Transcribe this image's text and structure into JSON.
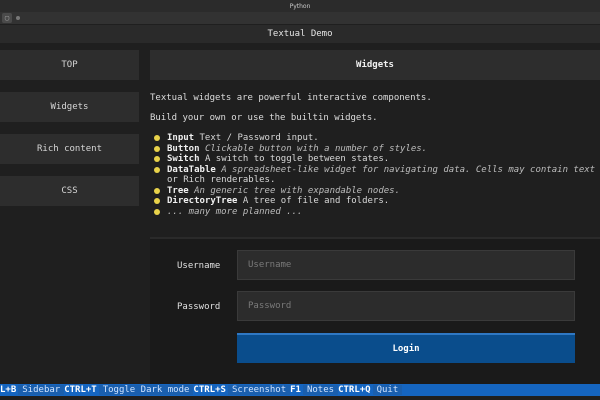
{
  "window": {
    "title": "Python"
  },
  "app": {
    "title": "Textual Demo"
  },
  "sidebar": {
    "items": [
      {
        "label": "TOP"
      },
      {
        "label": "Widgets"
      },
      {
        "label": "Rich content"
      },
      {
        "label": "CSS"
      }
    ]
  },
  "main": {
    "section_title": "Widgets",
    "intro": "Textual widgets are powerful interactive components.",
    "intro2": "Build your own or use the builtin widgets.",
    "list": [
      {
        "name": "Input",
        "desc": "Text / Password input."
      },
      {
        "name": "Button",
        "desc": "Clickable button with a number of styles."
      },
      {
        "name": "Switch",
        "desc": "A switch to toggle between states."
      },
      {
        "name": "DataTable",
        "desc": "A spreadsheet-like widget for navigating data. Cells may contain text",
        "desc2": "or Rich renderables."
      },
      {
        "name": "Tree",
        "desc": "An generic tree with expandable nodes."
      },
      {
        "name": "DirectoryTree",
        "desc": "A tree of file and folders."
      },
      {
        "name": "",
        "desc": "... many more planned ..."
      }
    ]
  },
  "login": {
    "username_label": "Username",
    "username_placeholder": "Username",
    "password_label": "Password",
    "password_placeholder": "Password",
    "button_label": "Login"
  },
  "footer": {
    "bindings": [
      {
        "key": "L+B",
        "desc": "Sidebar"
      },
      {
        "key": "CTRL+T",
        "desc": "Toggle Dark mode"
      },
      {
        "key": "CTRL+S",
        "desc": "Screenshot"
      },
      {
        "key": "F1",
        "desc": "Notes"
      },
      {
        "key": "CTRL+Q",
        "desc": "Quit"
      }
    ]
  },
  "colors": {
    "accent": "#1565c0",
    "bullet": "#e8d24a",
    "button": "#0a4d8c"
  }
}
